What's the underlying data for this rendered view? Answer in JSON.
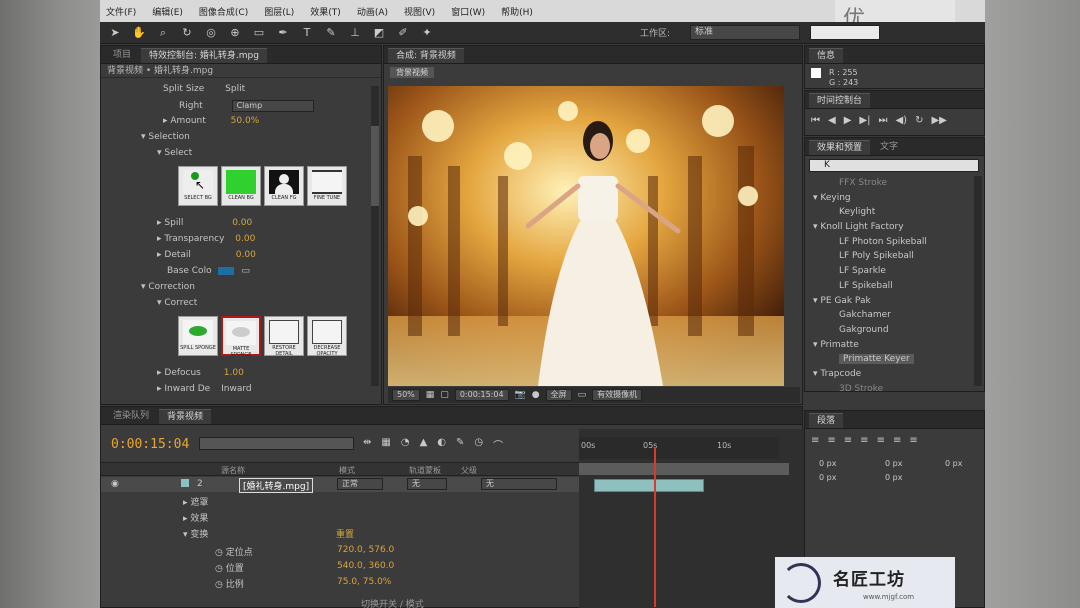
{
  "menu": [
    "文件(F)",
    "编辑(E)",
    "图像合成(C)",
    "图层(L)",
    "效果(T)",
    "动画(A)",
    "视图(V)",
    "窗口(W)",
    "帮助(H)"
  ],
  "watermark_top": "优",
  "toolbar": {
    "workspace_label": "工作区:",
    "workspace_value": "标准"
  },
  "effect_controls": {
    "tab_project": "项目",
    "tab_title": "特效控制台: 婚礼转身.mpg",
    "subheader": "背景视频 • 婚礼转身.mpg",
    "rows": {
      "split_size": {
        "label": "Split Size",
        "value": "Split"
      },
      "right": {
        "label": "Right",
        "value": "Clamp"
      },
      "amount": {
        "label": "Amount",
        "value": "50.0%"
      },
      "selection": "Selection",
      "select": "Select",
      "spill": {
        "label": "Spill",
        "value": "0.00"
      },
      "transparency": {
        "label": "Transparency",
        "value": "0.00"
      },
      "detail": {
        "label": "Detail",
        "value": "0.00"
      },
      "base_color": {
        "label": "Base Colo"
      },
      "correction": "Correction",
      "correct": "Correct",
      "defocus": {
        "label": "Defocus",
        "value": "1.00"
      },
      "inward": {
        "label": "Inward De",
        "value": "Inward"
      }
    },
    "select_buttons": [
      "SELECT BG",
      "CLEAN BG",
      "CLEAN FG",
      "FINE TUNE"
    ],
    "correct_buttons": [
      "SPILL SPONGE",
      "MATTE SPONGE",
      "RESTORE DETAIL",
      "DECREASE OPACITY"
    ]
  },
  "composition": {
    "tab_title": "合成: 背景视频",
    "crumb": "背景视频",
    "zoom": "50%",
    "timecode": "0:00:15:04",
    "resolution": "全屏",
    "camera": "有效摄像机"
  },
  "info": {
    "tab": "信息",
    "r": "R : 255",
    "g": "G : 243"
  },
  "preview": {
    "tab": "时间控制台"
  },
  "effects_presets": {
    "tab": "效果和预置",
    "tab2": "文字",
    "search_value": "K",
    "items": [
      "FFX Stroke",
      "Keying",
      "Keylight",
      "Knoll Light Factory",
      "LF Photon Spikeball",
      "LF Poly Spikeball",
      "LF Sparkle",
      "LF Spikeball",
      "PE Gak Pak",
      "Gakchamer",
      "Gakground",
      "Primatte",
      "Primatte Keyer",
      "Trapcode",
      "3D Stroke"
    ]
  },
  "paragraph": {
    "tab": "段落",
    "v1": "0 px",
    "v2": "0 px",
    "v3": "0 px",
    "v4": "0 px",
    "v5": "0 px"
  },
  "timeline": {
    "tab_render": "渲染队列",
    "tab_comp": "背景视频",
    "timecode": "0:00:15:04",
    "header": {
      "name": "源名称",
      "mode": "模式",
      "trkmat": "轨道蒙板",
      "parent": "父级"
    },
    "layer": {
      "index": "2",
      "name": "[婚礼转身.mpg]",
      "mode": "正常",
      "trkmat": "无",
      "parent": "无"
    },
    "sub": {
      "masks": "遮罩",
      "effects": "效果",
      "transform": "变换",
      "reset": "重置",
      "anchor": {
        "label": "定位点",
        "value": "720.0, 576.0"
      },
      "position": {
        "label": "位置",
        "value": "540.0, 360.0"
      },
      "scale": {
        "label": "比例",
        "value": "75.0, 75.0%"
      }
    },
    "ruler": [
      "00s",
      "05s",
      "10s"
    ],
    "footer": "切换开关 / 模式"
  },
  "logo": {
    "text": "名匠工坊",
    "sub": "www.mjgf.com"
  }
}
